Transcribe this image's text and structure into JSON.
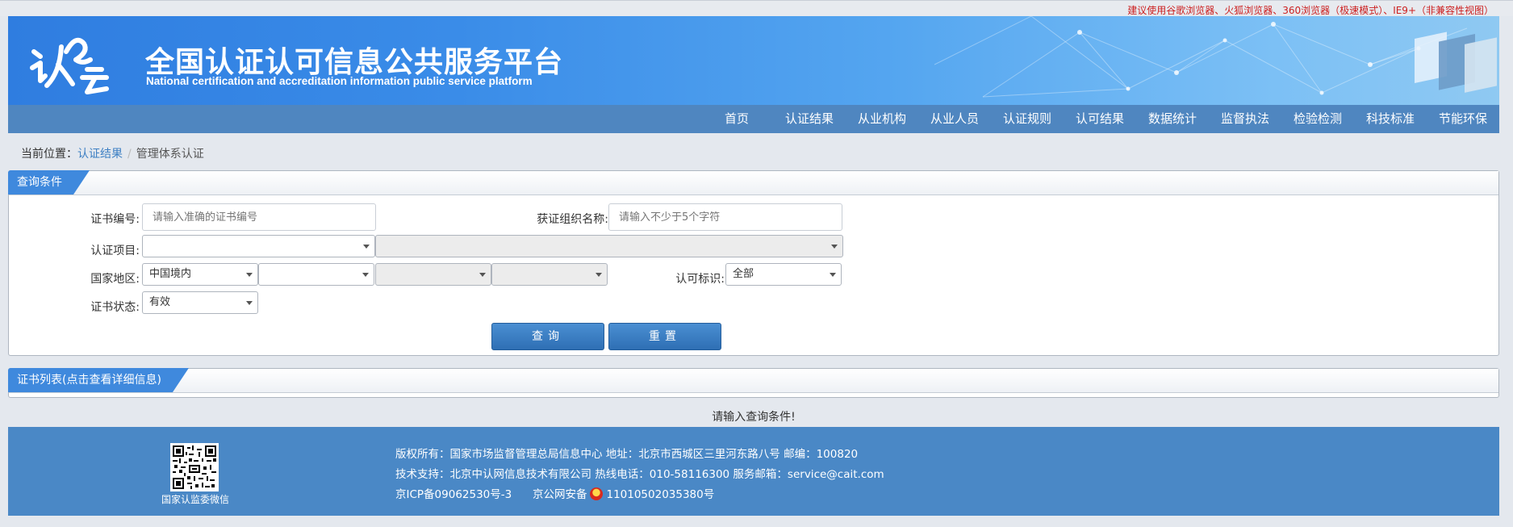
{
  "top_notice": "建议使用谷歌浏览器、火狐浏览器、360浏览器（极速模式）、IE9+（非兼容性视图）",
  "header": {
    "logo_text": "认e云",
    "title": "全国认证认可信息公共服务平台",
    "subtitle": "National certification and accreditation information public service platform"
  },
  "nav": {
    "items": [
      "首页",
      "认证结果",
      "从业机构",
      "从业人员",
      "认证规则",
      "认可结果",
      "数据统计",
      "监督执法",
      "检验检测",
      "科技标准",
      "节能环保"
    ]
  },
  "breadcrumb": {
    "label": "当前位置：",
    "link": "认证结果",
    "separator": "/",
    "current": "管理体系认证"
  },
  "query_panel": {
    "title": "查询条件",
    "cert_no_label": "证书编号:",
    "cert_no_placeholder": "请输入准确的证书编号",
    "org_name_label": "获证组织名称:",
    "org_name_placeholder": "请输入不少于5个字符",
    "project_label": "认证项目:",
    "project_value": "",
    "project_sub_value": "",
    "region_label": "国家地区:",
    "region_value": "中国境内",
    "region_2_value": "",
    "region_3_value": "",
    "region_4_value": "",
    "accred_label": "认可标识:",
    "accred_value": "全部",
    "status_label": "证书状态:",
    "status_value": "有效",
    "query_button": "查询",
    "reset_button": "重置"
  },
  "list_panel": {
    "title": "证书列表(点击查看详细信息)"
  },
  "hint": "请输入查询条件!",
  "footer": {
    "qr_caption": "国家认监委微信",
    "line1": "版权所有：国家市场监督管理总局信息中心    地址：北京市西城区三里河东路八号    邮编：100820",
    "line2": "技术支持：北京中认网信息技术有限公司    热线电话：010-58116300    服务邮箱：service@cait.com",
    "icp": "京ICP备09062530号-3",
    "police_prefix": "京公网安备",
    "police_no": "11010502035380号"
  },
  "colors": {
    "banner_blue": "#3a8ce8",
    "nav_blue": "#4f86c0",
    "tab_blue": "#3f89dd",
    "button_blue": "#2e6fb4",
    "footer_blue": "#4a88c6",
    "notice_red": "#cc2020"
  }
}
